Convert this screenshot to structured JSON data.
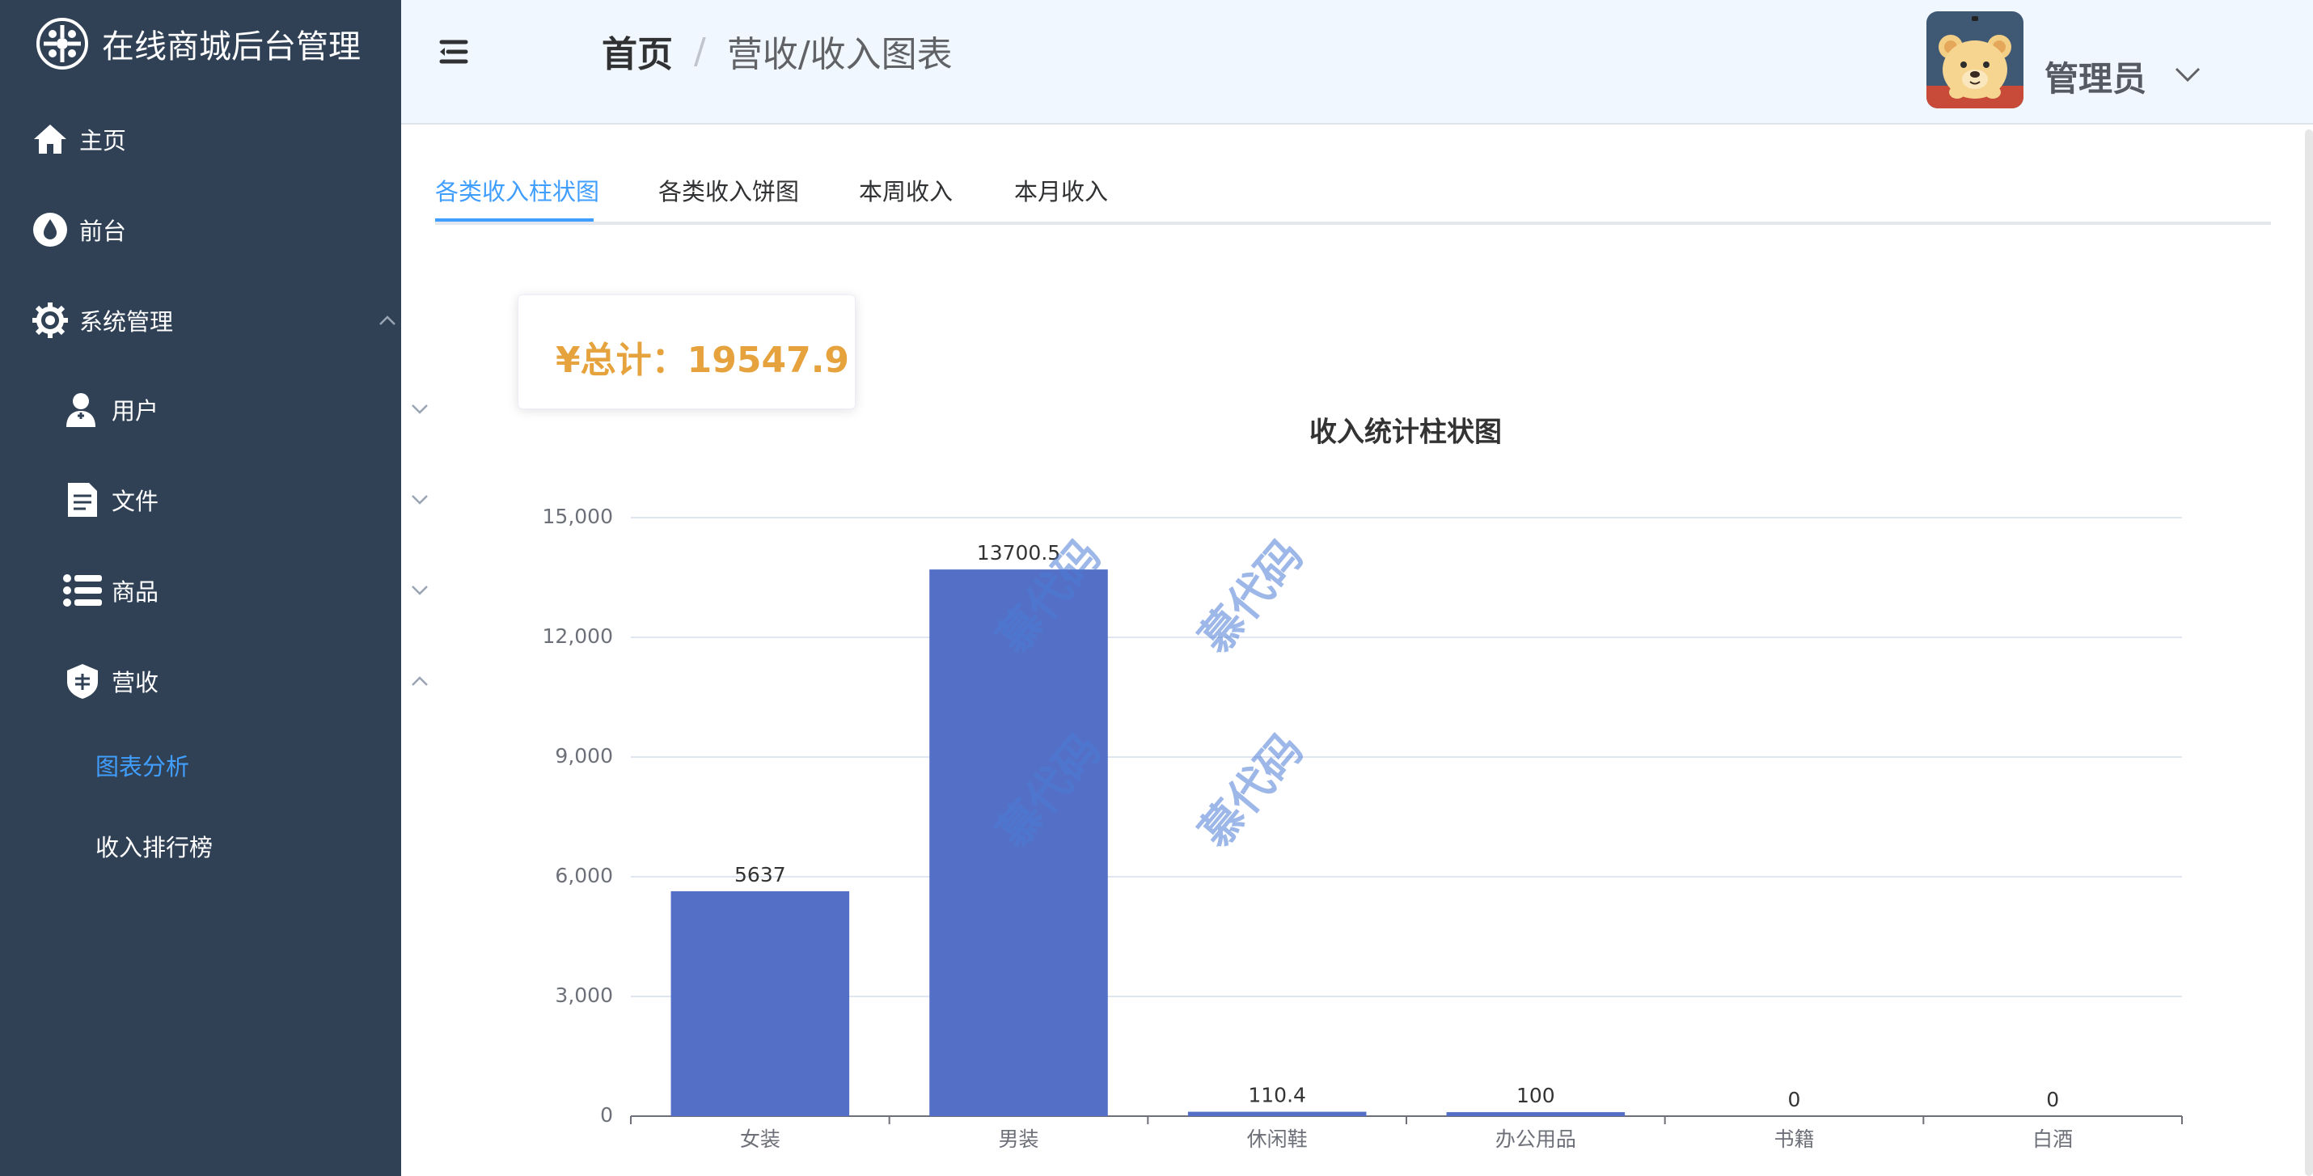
{
  "app": {
    "title": "在线商城后台管理"
  },
  "sidebar": {
    "items": [
      {
        "label": "主页",
        "icon": "home-icon"
      },
      {
        "label": "前台",
        "icon": "droplet-icon"
      },
      {
        "label": "系统管理",
        "icon": "gear-icon",
        "expanded": true
      },
      {
        "label": "用户",
        "icon": "user-plus-icon"
      },
      {
        "label": "文件",
        "icon": "document-icon"
      },
      {
        "label": "商品",
        "icon": "list-icon"
      },
      {
        "label": "营收",
        "icon": "badge-icon",
        "expanded": true
      }
    ],
    "sub_items": [
      {
        "label": "图表分析",
        "active": true
      },
      {
        "label": "收入排行榜",
        "active": false
      }
    ]
  },
  "header": {
    "breadcrumb": {
      "home": "首页",
      "separator": "/",
      "current": "营收/收入图表"
    },
    "user": {
      "name": "管理员"
    }
  },
  "tabs": [
    {
      "label": "各类收入柱状图",
      "active": true
    },
    {
      "label": "各类收入饼图",
      "active": false
    },
    {
      "label": "本周收入",
      "active": false
    },
    {
      "label": "本月收入",
      "active": false
    }
  ],
  "summary": {
    "total": "¥总计：19547.9"
  },
  "watermark": {
    "text": "慕代码"
  },
  "colors": {
    "sidebar_bg": "#304156",
    "accent": "#409eff",
    "bar": "#5470c6",
    "total": "#e6a23c",
    "header_bg": "#f0f7ff"
  },
  "chart_data": {
    "type": "bar",
    "title": "收入统计柱状图",
    "categories": [
      "女装",
      "男装",
      "休闲鞋",
      "办公用品",
      "书籍",
      "白酒"
    ],
    "values": [
      5637,
      13700.5,
      110.4,
      100,
      0,
      0
    ],
    "ylim": [
      0,
      15000
    ],
    "yticks": [
      0,
      3000,
      6000,
      9000,
      12000,
      15000
    ],
    "ytick_labels": [
      "0",
      "3,000",
      "6,000",
      "9,000",
      "12,000",
      "15,000"
    ],
    "data_labels": [
      "5637",
      "13700.5",
      "110.4",
      "100",
      "0",
      "0"
    ],
    "grid": true,
    "xlabel": "",
    "ylabel": ""
  }
}
